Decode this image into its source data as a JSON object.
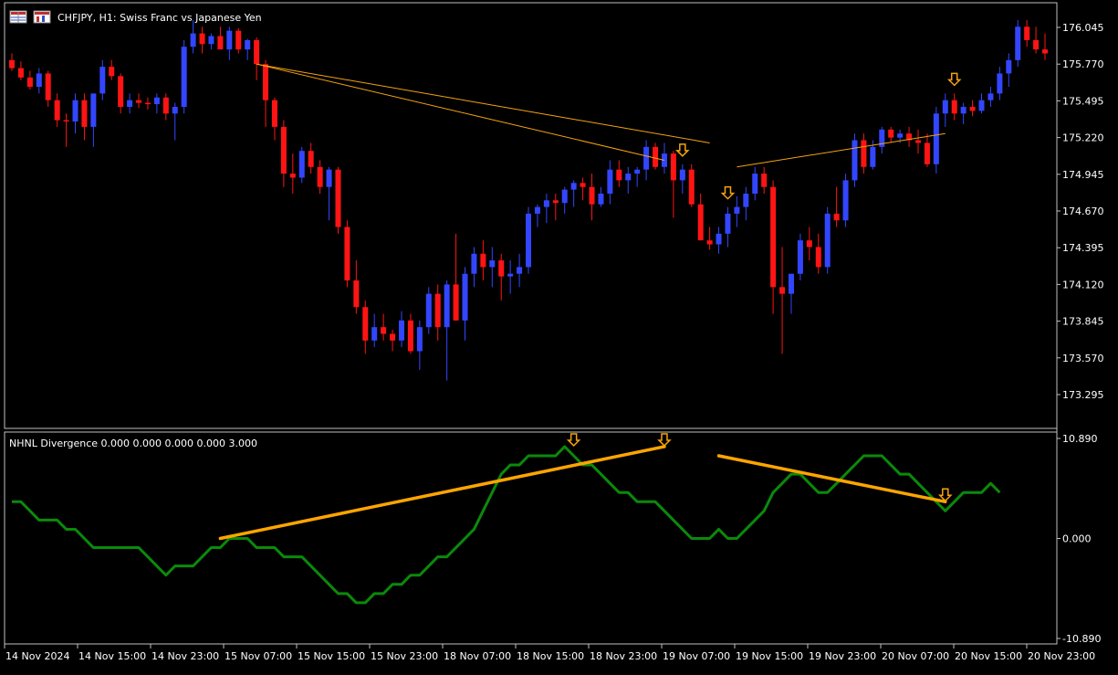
{
  "header": {
    "title": "CHFJPY, H1:  Swiss Franc vs Japanese Yen",
    "icon_left": "chart-grid-icon",
    "icon_right": "chart-window-icon"
  },
  "indicator": {
    "label": "NHNL Divergence 0.000 0.000 0.000 0.000 3.000"
  },
  "colors": {
    "background": "#000000",
    "frame": "#c0c0c0",
    "bull": "#3346ff",
    "bear": "#ff1414",
    "arrow": "#f5a30f",
    "trend": "#f5a30f",
    "indicator_line": "#0a8a0a",
    "indicator_div": "#ffa500"
  },
  "price_axis": [
    "176.045",
    "175.770",
    "175.495",
    "175.220",
    "174.945",
    "174.670",
    "174.395",
    "174.120",
    "173.845",
    "173.570",
    "173.295"
  ],
  "indicator_axis": [
    "10.890",
    "0.000",
    "-10.890"
  ],
  "time_axis": [
    "14 Nov 2024",
    "14 Nov 15:00",
    "14 Nov 23:00",
    "15 Nov 07:00",
    "15 Nov 15:00",
    "15 Nov 23:00",
    "18 Nov 07:00",
    "18 Nov 15:00",
    "18 Nov 23:00",
    "19 Nov 07:00",
    "19 Nov 15:00",
    "19 Nov 23:00",
    "20 Nov 07:00",
    "20 Nov 15:00",
    "20 Nov 23:00"
  ],
  "chart_data": {
    "type": "candlestick",
    "symbol": "CHFJPY",
    "timeframe": "H1",
    "ylim": [
      173.13,
      176.21
    ],
    "candles": [
      [
        175.8,
        175.85,
        175.72,
        175.74
      ],
      [
        175.74,
        175.79,
        175.65,
        175.67
      ],
      [
        175.67,
        175.72,
        175.58,
        175.6
      ],
      [
        175.6,
        175.74,
        175.55,
        175.7
      ],
      [
        175.7,
        175.72,
        175.45,
        175.5
      ],
      [
        175.5,
        175.55,
        175.3,
        175.35
      ],
      [
        175.35,
        175.4,
        175.15,
        175.34
      ],
      [
        175.34,
        175.55,
        175.25,
        175.5
      ],
      [
        175.5,
        175.55,
        175.2,
        175.3
      ],
      [
        175.3,
        175.55,
        175.15,
        175.55
      ],
      [
        175.55,
        175.8,
        175.5,
        175.75
      ],
      [
        175.75,
        175.8,
        175.65,
        175.68
      ],
      [
        175.68,
        175.7,
        175.4,
        175.45
      ],
      [
        175.45,
        175.55,
        175.4,
        175.5
      ],
      [
        175.5,
        175.55,
        175.44,
        175.48
      ],
      [
        175.48,
        175.52,
        175.43,
        175.47
      ],
      [
        175.47,
        175.55,
        175.4,
        175.52
      ],
      [
        175.52,
        175.55,
        175.35,
        175.4
      ],
      [
        175.4,
        175.48,
        175.2,
        175.45
      ],
      [
        175.45,
        175.95,
        175.4,
        175.9
      ],
      [
        175.9,
        176.1,
        175.85,
        176.0
      ],
      [
        176.0,
        176.05,
        175.85,
        175.92
      ],
      [
        175.92,
        176.0,
        175.88,
        175.98
      ],
      [
        175.98,
        176.05,
        175.9,
        175.88
      ],
      [
        175.88,
        176.05,
        175.8,
        176.02
      ],
      [
        176.02,
        176.04,
        175.85,
        175.88
      ],
      [
        175.88,
        175.96,
        175.8,
        175.95
      ],
      [
        175.95,
        175.97,
        175.65,
        175.77
      ],
      [
        175.77,
        175.8,
        175.3,
        175.5
      ],
      [
        175.5,
        175.52,
        175.2,
        175.3
      ],
      [
        175.3,
        175.35,
        174.85,
        174.95
      ],
      [
        174.95,
        175.1,
        174.8,
        174.92
      ],
      [
        174.92,
        175.15,
        174.88,
        175.12
      ],
      [
        175.12,
        175.18,
        174.95,
        175.0
      ],
      [
        175.0,
        175.05,
        174.8,
        174.85
      ],
      [
        174.85,
        175.0,
        174.6,
        174.98
      ],
      [
        174.98,
        175.0,
        174.5,
        174.55
      ],
      [
        174.55,
        174.6,
        174.1,
        174.15
      ],
      [
        174.15,
        174.3,
        173.9,
        173.95
      ],
      [
        173.95,
        174.0,
        173.6,
        173.7
      ],
      [
        173.7,
        173.9,
        173.65,
        173.8
      ],
      [
        173.8,
        173.9,
        173.7,
        173.75
      ],
      [
        173.75,
        173.78,
        173.62,
        173.7
      ],
      [
        173.7,
        173.92,
        173.65,
        173.85
      ],
      [
        173.85,
        173.9,
        173.6,
        173.62
      ],
      [
        173.62,
        173.85,
        173.48,
        173.8
      ],
      [
        173.8,
        174.1,
        173.75,
        174.05
      ],
      [
        174.05,
        174.12,
        173.7,
        173.8
      ],
      [
        173.8,
        174.15,
        173.4,
        174.12
      ],
      [
        174.12,
        174.5,
        173.85,
        173.85
      ],
      [
        173.85,
        174.25,
        173.7,
        174.2
      ],
      [
        174.2,
        174.4,
        174.1,
        174.35
      ],
      [
        174.35,
        174.45,
        174.15,
        174.25
      ],
      [
        174.25,
        174.4,
        174.1,
        174.3
      ],
      [
        174.3,
        174.35,
        174.0,
        174.18
      ],
      [
        174.18,
        174.3,
        174.05,
        174.2
      ],
      [
        174.2,
        174.35,
        174.1,
        174.25
      ],
      [
        174.25,
        174.7,
        174.2,
        174.65
      ],
      [
        174.65,
        174.72,
        174.55,
        174.7
      ],
      [
        174.7,
        174.8,
        174.58,
        174.75
      ],
      [
        174.75,
        174.8,
        174.6,
        174.73
      ],
      [
        174.73,
        174.85,
        174.65,
        174.83
      ],
      [
        174.83,
        174.9,
        174.7,
        174.88
      ],
      [
        174.88,
        174.92,
        174.75,
        174.85
      ],
      [
        174.85,
        174.95,
        174.6,
        174.72
      ],
      [
        174.72,
        174.85,
        174.7,
        174.8
      ],
      [
        174.8,
        175.05,
        174.72,
        174.98
      ],
      [
        174.98,
        175.05,
        174.85,
        174.9
      ],
      [
        174.9,
        175.0,
        174.8,
        174.95
      ],
      [
        174.95,
        175.0,
        174.85,
        174.98
      ],
      [
        174.98,
        175.2,
        174.9,
        175.15
      ],
      [
        175.15,
        175.18,
        174.98,
        175.0
      ],
      [
        175.0,
        175.18,
        174.95,
        175.1
      ],
      [
        175.1,
        175.12,
        174.62,
        174.9
      ],
      [
        174.9,
        175.02,
        174.8,
        174.98
      ],
      [
        174.98,
        175.02,
        174.7,
        174.72
      ],
      [
        174.72,
        174.8,
        174.45,
        174.45
      ],
      [
        174.45,
        174.55,
        174.38,
        174.42
      ],
      [
        174.42,
        174.55,
        174.35,
        174.5
      ],
      [
        174.5,
        174.7,
        174.4,
        174.65
      ],
      [
        174.65,
        174.78,
        174.55,
        174.7
      ],
      [
        174.7,
        174.85,
        174.6,
        174.8
      ],
      [
        174.8,
        175.0,
        174.75,
        174.95
      ],
      [
        174.95,
        175.0,
        174.8,
        174.85
      ],
      [
        174.85,
        174.9,
        173.9,
        174.1
      ],
      [
        174.1,
        174.4,
        173.6,
        174.05
      ],
      [
        174.05,
        174.2,
        173.9,
        174.2
      ],
      [
        174.2,
        174.5,
        174.15,
        174.45
      ],
      [
        174.45,
        174.55,
        174.3,
        174.4
      ],
      [
        174.4,
        174.5,
        174.2,
        174.25
      ],
      [
        174.25,
        174.7,
        174.2,
        174.65
      ],
      [
        174.65,
        174.85,
        174.55,
        174.6
      ],
      [
        174.6,
        174.95,
        174.55,
        174.9
      ],
      [
        174.9,
        175.25,
        174.85,
        175.2
      ],
      [
        175.2,
        175.25,
        174.95,
        175.0
      ],
      [
        175.0,
        175.2,
        174.98,
        175.15
      ],
      [
        175.15,
        175.3,
        175.1,
        175.28
      ],
      [
        175.28,
        175.3,
        175.18,
        175.22
      ],
      [
        175.22,
        175.28,
        175.18,
        175.25
      ],
      [
        175.25,
        175.3,
        175.15,
        175.2
      ],
      [
        175.2,
        175.28,
        175.1,
        175.18
      ],
      [
        175.18,
        175.25,
        175.0,
        175.02
      ],
      [
        175.02,
        175.45,
        174.95,
        175.4
      ],
      [
        175.4,
        175.55,
        175.3,
        175.5
      ],
      [
        175.5,
        175.55,
        175.35,
        175.4
      ],
      [
        175.4,
        175.48,
        175.32,
        175.45
      ],
      [
        175.45,
        175.5,
        175.38,
        175.42
      ],
      [
        175.42,
        175.55,
        175.4,
        175.5
      ],
      [
        175.5,
        175.6,
        175.45,
        175.55
      ],
      [
        175.55,
        175.75,
        175.5,
        175.7
      ],
      [
        175.7,
        175.85,
        175.6,
        175.8
      ],
      [
        175.8,
        176.1,
        175.75,
        176.05
      ],
      [
        176.05,
        176.1,
        175.9,
        175.95
      ],
      [
        175.95,
        176.05,
        175.85,
        175.88
      ],
      [
        175.88,
        176.0,
        175.8,
        175.85
      ],
      [
        175.85,
        176.05,
        175.82,
        176.0
      ],
      [
        176.0,
        176.1,
        175.95,
        176.05
      ],
      [
        176.05,
        176.15,
        175.95,
        176.1
      ],
      [
        176.1,
        176.12,
        175.75,
        175.8
      ],
      [
        175.8,
        175.85,
        175.45,
        175.65
      ],
      [
        175.65,
        175.75,
        175.35,
        175.45
      ],
      [
        175.45,
        175.6,
        175.4,
        175.55
      ],
      [
        175.55,
        175.7,
        175.5,
        175.65
      ],
      [
        175.65,
        175.75,
        175.6,
        175.7
      ],
      [
        175.7,
        175.85,
        175.62,
        175.75
      ],
      [
        175.75,
        175.8,
        175.6,
        175.7
      ],
      [
        175.7,
        175.72,
        175.45,
        175.5
      ],
      [
        175.5,
        175.75,
        175.45,
        175.72
      ]
    ],
    "trendlines": [
      {
        "from": [
          175.77
        ],
        "to": [
          175.05
        ],
        "from_index": 27,
        "to_index": 72
      },
      {
        "from": [
          175.77
        ],
        "to": [
          175.18
        ],
        "from_index": 27,
        "to_index": 77
      },
      {
        "from": [
          175.0
        ],
        "to": [
          175.25
        ],
        "from_index": 80,
        "to_index": 103
      }
    ],
    "signal_arrows_indices": [
      74,
      79,
      104
    ],
    "indicator": {
      "ylim": [
        -10.89,
        10.89
      ],
      "values": [
        4,
        4,
        3,
        2,
        2,
        2,
        1,
        1,
        0,
        -1,
        -1,
        -1,
        -1,
        -1,
        -1,
        -2,
        -3,
        -4,
        -3,
        -3,
        -3,
        -2,
        -1,
        -1,
        0,
        0,
        0,
        -1,
        -1,
        -1,
        -2,
        -2,
        -2,
        -3,
        -4,
        -5,
        -6,
        -6,
        -7,
        -7,
        -6,
        -6,
        -5,
        -5,
        -4,
        -4,
        -3,
        -2,
        -2,
        -1,
        0,
        1,
        3,
        5,
        7,
        8,
        8,
        9,
        9,
        9,
        9,
        10,
        9,
        8,
        8,
        7,
        6,
        5,
        5,
        4,
        4,
        4,
        3,
        2,
        1,
        0,
        0,
        0,
        1,
        0,
        0,
        1,
        2,
        3,
        5,
        6,
        7,
        7,
        6,
        5,
        5,
        6,
        7,
        8,
        9,
        9,
        9,
        8,
        7,
        7,
        6,
        5,
        4,
        3,
        4,
        5,
        5,
        5,
        6,
        5
      ],
      "divergences": [
        {
          "from_index": 23,
          "to_index": 72,
          "from": 0,
          "to": 10
        },
        {
          "from_index": 78,
          "to_index": 103,
          "from": 9,
          "to": 4
        }
      ]
    }
  }
}
